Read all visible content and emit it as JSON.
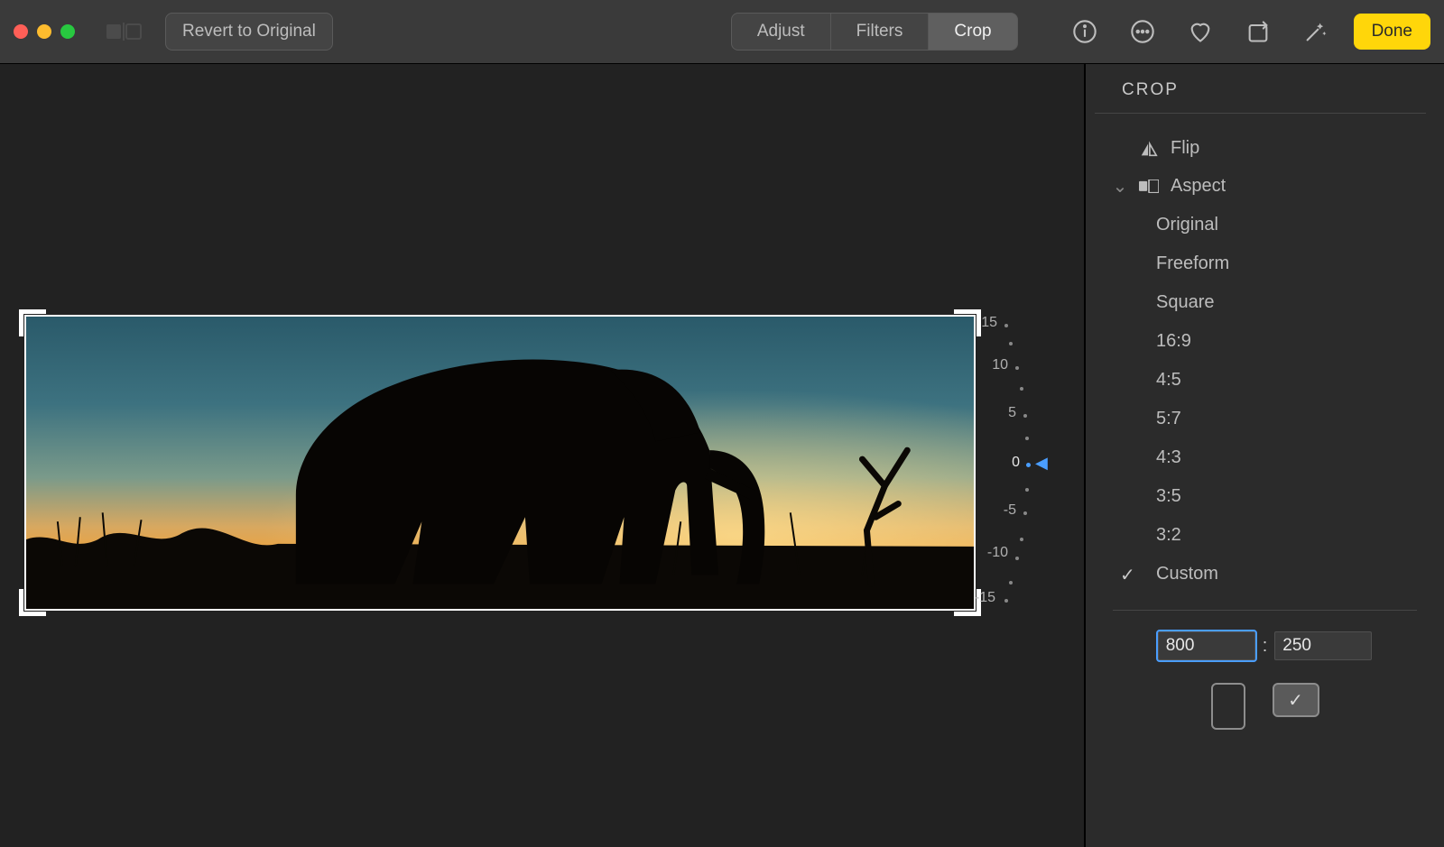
{
  "toolbar": {
    "revert_label": "Revert to Original",
    "tabs": {
      "adjust": "Adjust",
      "filters": "Filters",
      "crop": "Crop"
    },
    "done_label": "Done"
  },
  "rotation": {
    "labels": [
      "15",
      "10",
      "5",
      "0",
      "-5",
      "-10",
      "-15"
    ],
    "current": "0"
  },
  "sidebar": {
    "title": "CROP",
    "flip_label": "Flip",
    "aspect_label": "Aspect",
    "aspects": {
      "original": "Original",
      "freeform": "Freeform",
      "square": "Square",
      "r16_9": "16:9",
      "r4_5": "4:5",
      "r5_7": "5:7",
      "r4_3": "4:3",
      "r3_5": "3:5",
      "r3_2": "3:2",
      "custom": "Custom"
    },
    "custom_width": "800",
    "custom_height": "250",
    "colon": ":"
  }
}
